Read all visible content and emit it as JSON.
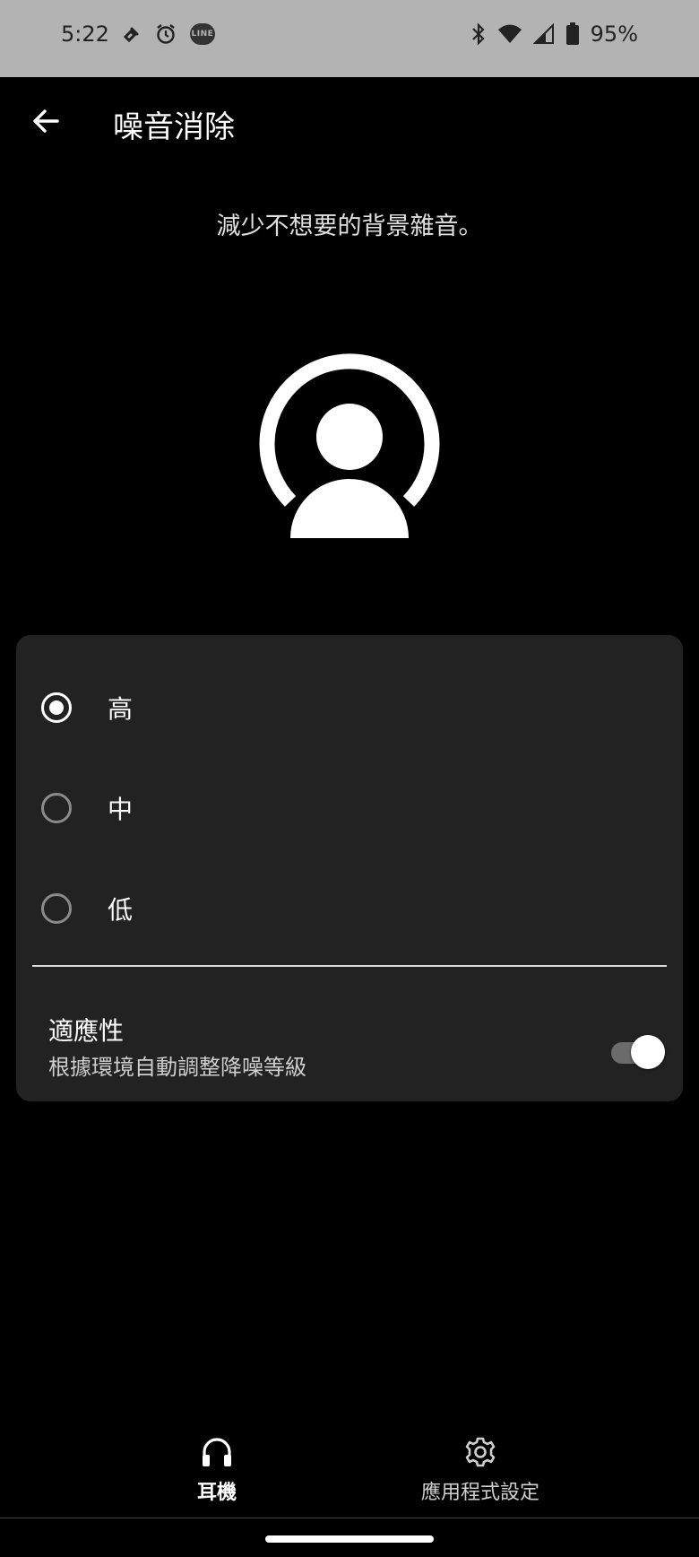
{
  "status_bar": {
    "time": "5:22",
    "battery_percent": "95%",
    "line_badge": "LINE",
    "icons": [
      "pin-icon",
      "alarm-icon",
      "line-app-icon",
      "bluetooth-icon",
      "wifi-icon",
      "signal-icon",
      "battery-icon"
    ]
  },
  "header": {
    "title": "噪音消除",
    "back_icon": "arrow-left-icon"
  },
  "description": "減少不想要的背景雜音。",
  "options": {
    "items": [
      {
        "label": "高",
        "checked": true
      },
      {
        "label": "中",
        "checked": false
      },
      {
        "label": "低",
        "checked": false
      }
    ]
  },
  "adaptive": {
    "title": "適應性",
    "subtitle": "根據環境自動調整降噪等級",
    "enabled": true
  },
  "bottom_nav": {
    "items": [
      {
        "label": "耳機",
        "icon": "headphones-icon",
        "active": true
      },
      {
        "label": "應用程式設定",
        "icon": "gear-icon",
        "active": false
      }
    ]
  },
  "colors": {
    "background": "#000000",
    "status_bar": "#b3b3b3",
    "card": "#222222",
    "toggle_track": "#6b6b6b"
  }
}
